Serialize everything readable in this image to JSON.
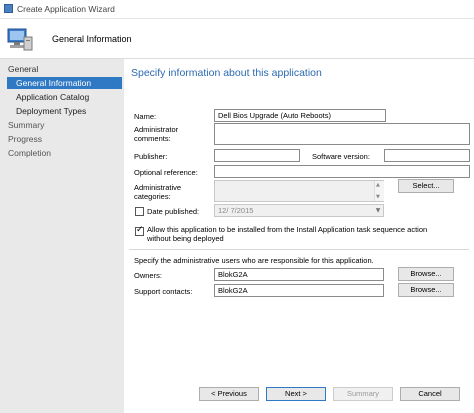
{
  "window": {
    "title": "Create Application Wizard"
  },
  "header": {
    "title": "General Information"
  },
  "sidebar": {
    "group": "General",
    "items": [
      {
        "label": "General Information"
      },
      {
        "label": "Application Catalog"
      },
      {
        "label": "Deployment Types"
      }
    ],
    "steps": [
      {
        "label": "Summary"
      },
      {
        "label": "Progress"
      },
      {
        "label": "Completion"
      }
    ]
  },
  "main": {
    "section_title": "Specify information about this application",
    "fields": {
      "name_label": "Name:",
      "name_value": "Dell Bios Upgrade (Auto Reboots)",
      "comments_label": "Administrator comments:",
      "comments_value": "",
      "publisher_label": "Publisher:",
      "publisher_value": "",
      "software_version_label": "Software version:",
      "software_version_value": "",
      "optional_reference_label": "Optional reference:",
      "optional_reference_value": "",
      "admin_categories_label": "Administrative categories:",
      "admin_categories_value": "",
      "select_button": "Select...",
      "date_published_label": "Date published:",
      "date_published_value": "12/  7/2015",
      "date_published_checked": false,
      "allow_install_label": "Allow this application to be installed from the Install Application task sequence action without being deployed",
      "allow_install_checked": true
    },
    "admin_users": {
      "instruction": "Specify the administrative users who are responsible for this application.",
      "owners_label": "Owners:",
      "owners_value": "BlokG2A",
      "support_label": "Support contacts:",
      "support_value": "BlokG2A",
      "browse_label": "Browse..."
    }
  },
  "footer": {
    "previous": "< Previous",
    "next": "Next >",
    "summary": "Summary",
    "cancel": "Cancel"
  },
  "colors": {
    "accent": "#2f78c4",
    "title_blue": "#2b6ab0",
    "sidebar_bg": "#e9e9e9"
  }
}
